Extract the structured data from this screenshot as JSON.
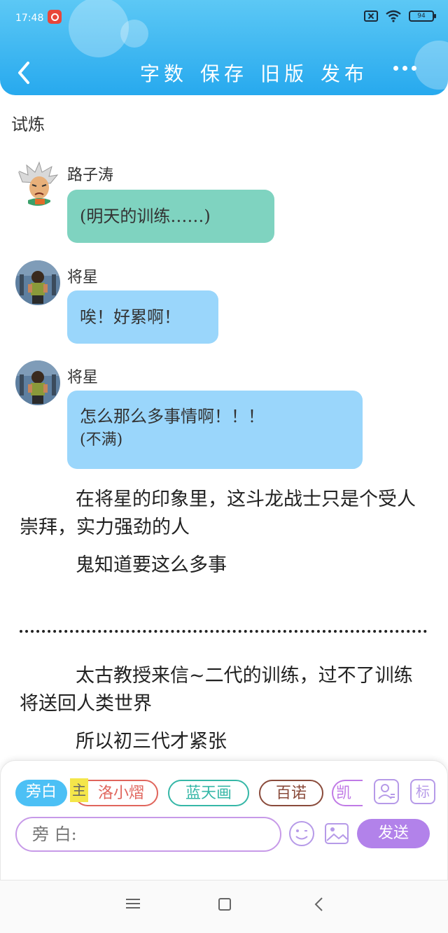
{
  "status_bar": {
    "time": "17:48",
    "battery": "94"
  },
  "toolbar": {
    "actions": [
      "字数",
      "保存",
      "旧版",
      "发布"
    ]
  },
  "story": {
    "title": "试炼",
    "messages": [
      {
        "speaker": "路子涛",
        "text": "(明天的训练……)",
        "color": "#7fd3c0"
      },
      {
        "speaker": "将星",
        "text": "唉！好累啊！",
        "color": "#9ad6fb"
      },
      {
        "speaker": "将星",
        "line1": "怎么那么多事情啊！！！",
        "line2": "(不满)",
        "color": "#9ad6fb"
      }
    ],
    "narration": [
      "在将星的印象里，这斗龙战士只是个受人崇拜，实力强劲的人",
      "鬼知道要这么多事",
      "太古教授来信~二代的训练，过不了训练将送回人类世界",
      "所以初三代才紧张"
    ]
  },
  "input_panel": {
    "active_role": "旁白",
    "marker": "主",
    "roles": [
      "洛小熠",
      "蓝天画",
      "百诺",
      "凯"
    ],
    "role_icon_label": "角色",
    "tag_label": "标",
    "input_placeholder": "旁 白:",
    "send_label": "发送"
  },
  "colors": {
    "header": "#27a9ee",
    "teal_bubble": "#7fd3c0",
    "blue_bubble": "#9ad6fb",
    "send": "#b282ea"
  }
}
